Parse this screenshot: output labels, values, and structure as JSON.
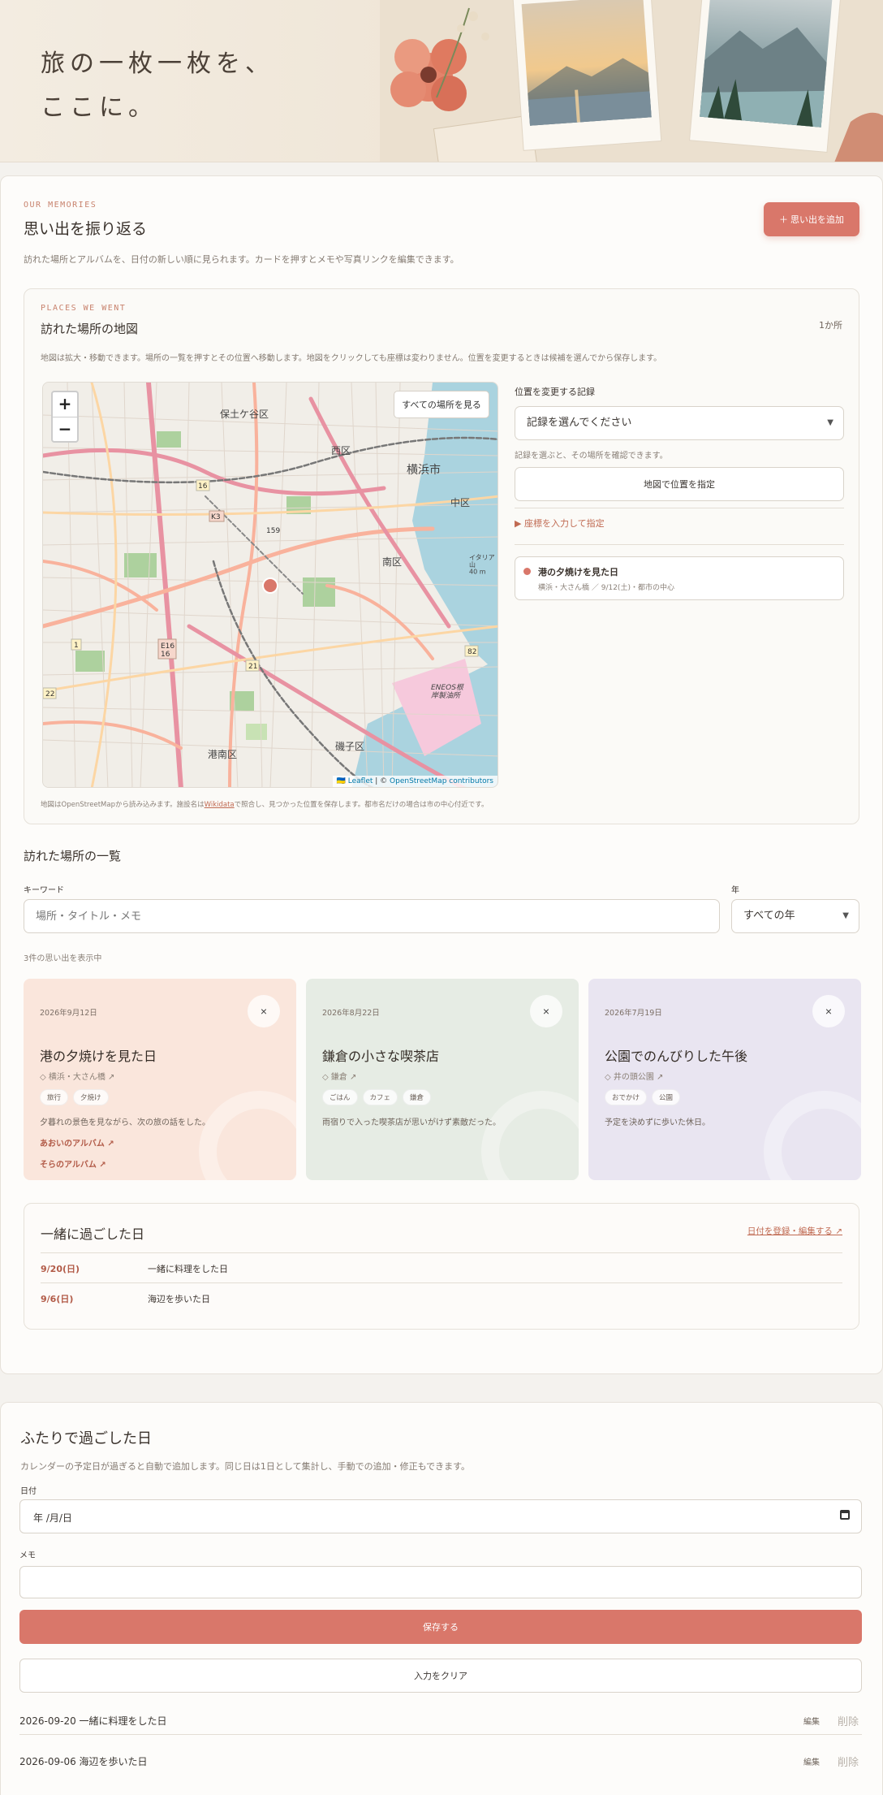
{
  "hero": {
    "title": "旅の一枚一枚を、\nここに。"
  },
  "memories": {
    "eyebrow": "OUR MEMORIES",
    "title": "思い出を振り返る",
    "description": "訪れた場所とアルバムを、日付の新しい順に見られます。カードを押すとメモや写真リンクを編集できます。",
    "add_button": "＋ 思い出を追加"
  },
  "map_panel": {
    "eyebrow": "PLACES WE WENT",
    "title": "訪れた場所の地図",
    "count": "1か所",
    "description": "地図は拡大・移動できます。場所の一覧を押すとその位置へ移動します。地図をクリックしても座標は変わりません。位置を変更するときは候補を選んでから保存します。",
    "zoom_in": "+",
    "zoom_out": "−",
    "show_all_button": "すべての場所を見る",
    "map_labels": [
      {
        "name": "label-hodogaya",
        "text": "保土ケ谷区"
      },
      {
        "name": "label-nishi",
        "text": "西区"
      },
      {
        "name": "label-yokohama",
        "text": "横浜市"
      },
      {
        "name": "label-naka",
        "text": "中区"
      },
      {
        "name": "label-minami",
        "text": "南区"
      },
      {
        "name": "label-konan",
        "text": "港南区"
      },
      {
        "name": "label-isogo",
        "text": "磯子区"
      },
      {
        "name": "label-eneos",
        "text": "ENEOS根\n岸製油所"
      },
      {
        "name": "label-k3",
        "text": "K3"
      },
      {
        "name": "label-e16",
        "text": "E16\n16"
      },
      {
        "name": "label-21",
        "text": "21"
      },
      {
        "name": "label-82",
        "text": "82"
      },
      {
        "name": "label-22",
        "text": "22"
      },
      {
        "name": "label-1",
        "text": "1"
      },
      {
        "name": "label-16",
        "text": "16"
      },
      {
        "name": "label-159",
        "text": "159"
      },
      {
        "name": "label-hill",
        "text": "イタリア\n山\n40 m"
      }
    ],
    "attribution_leaflet": "🇺🇦 Leaflet",
    "attribution_sep": " | © ",
    "attribution_osm": "OpenStreetMap contributors",
    "footnote_pre": "地図はOpenStreetMapから読み込みます。施設名は",
    "footnote_link": "Wikidata",
    "footnote_post": "で照合し、見つかった位置を保存します。都市名だけの場合は市の中心付近です。",
    "record_label": "位置を変更する記録",
    "record_select": "記録を選んでください",
    "record_help": "記録を選ぶと、その場所を確認できます。",
    "set_on_map_button": "地図で位置を指定",
    "coord_toggle": "▶ 座標を入力して指定",
    "place_item_title": "港の夕焼けを見た日",
    "place_item_sub": "横浜・大さん橋 ／ 9/12(土)・都市の中心"
  },
  "list": {
    "title": "訪れた場所の一覧",
    "keyword_label": "キーワード",
    "keyword_placeholder": "場所・タイトル・メモ",
    "year_label": "年",
    "year_select": "すべての年",
    "result_count": "3件の思い出を表示中",
    "cards": [
      {
        "date": "2026年9月12日",
        "close": "×",
        "title": "港の夕焼けを見た日",
        "place": "◇ 横浜・大さん橋 ↗",
        "tags": [
          "旅行",
          "夕焼け"
        ],
        "note": "夕暮れの景色を見ながら、次の旅の話をした。",
        "album1": "あおいのアルバム ↗",
        "album2": "そらのアルバム ↗",
        "bg": "#fae6dc"
      },
      {
        "date": "2026年8月22日",
        "close": "×",
        "title": "鎌倉の小さな喫茶店",
        "place": "◇ 鎌倉 ↗",
        "tags": [
          "ごはん",
          "カフェ",
          "鎌倉"
        ],
        "note": "雨宿りで入った喫茶店が思いがけず素敵だった。",
        "bg": "#e6ece4"
      },
      {
        "date": "2026年7月19日",
        "close": "×",
        "title": "公園でのんびりした午後",
        "place": "◇ 井の頭公園 ↗",
        "tags": [
          "おでかけ",
          "公園"
        ],
        "note": "予定を決めずに歩いた休日。",
        "bg": "#e9e5f1"
      }
    ]
  },
  "together": {
    "title": "一緒に過ごした日",
    "link": "日付を登録・編集する ↗",
    "rows": [
      {
        "date": "9/20(日)",
        "text": "一緒に料理をした日"
      },
      {
        "date": "9/6(日)",
        "text": "海辺を歩いた日"
      }
    ]
  },
  "two": {
    "title": "ふたりで過ごした日",
    "description": "カレンダーの予定日が過ぎると自動で追加します。同じ日は1日として集計し、手動での追加・修正もできます。",
    "date_label": "日付",
    "date_value": "年 /月/日",
    "memo_label": "メモ",
    "save_button": "保存する",
    "clear_button": "入力をクリア",
    "entries": [
      {
        "text": "2026-09-20 一緒に料理をした日",
        "edit": "編集",
        "delete": "削除"
      },
      {
        "text": "2026-09-06 海辺を歩いた日",
        "edit": "編集",
        "delete": "削除"
      }
    ]
  },
  "colors": {
    "accent": "#d9776a",
    "accent_text": "#b25b48",
    "background": "#f4f2ee",
    "card": "#fdfcfa"
  }
}
